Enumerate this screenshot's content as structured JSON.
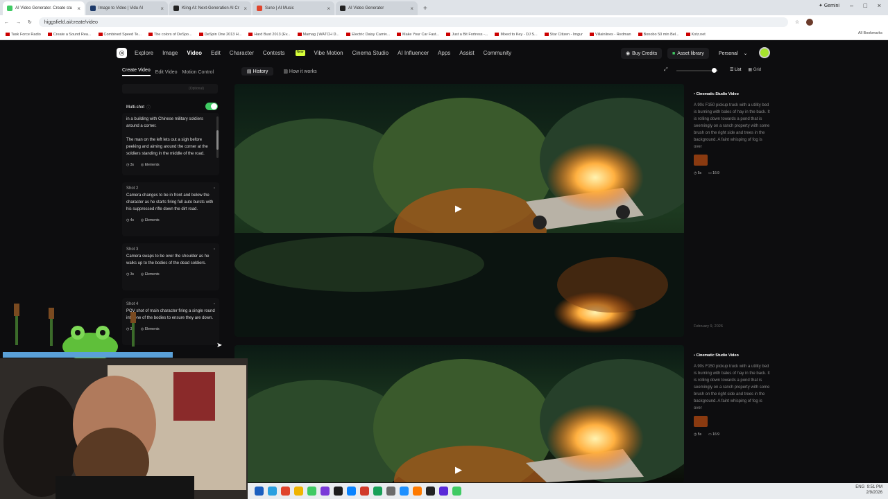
{
  "browser": {
    "tabs": [
      {
        "title": "AI Video Generator. Create stu",
        "color": "#3fca63",
        "active": true
      },
      {
        "title": "Image to Video | Vidu AI",
        "color": "#1d3a6a",
        "active": false
      },
      {
        "title": "Kling AI: Next-Generation AI Cr",
        "color": "#222222",
        "active": false
      },
      {
        "title": "Suno | AI Music",
        "color": "#e0442c",
        "active": false
      },
      {
        "title": "AI Video Generator",
        "color": "#222222",
        "active": false
      }
    ],
    "gemini_label": "Gemini",
    "url": "higgsfield.ai/create/video",
    "bookmarks": [
      "Task Force Radio",
      "Create a Sound Rea...",
      "Combined Speed Te...",
      "The colors of DeSpo...",
      "DeSpin One 2013 H...",
      "Hard Bust 2013 (Ev...",
      "Mamag | WATCH D...",
      "Electric Daisy Carniv...",
      "Make Your Car Fast...",
      "Just a Bit Fortress -...",
      "Mixed to Key - DJ S...",
      "Star Citizen - Imgur",
      "Villainlines - Redman",
      "Bonobo 50 min Bel...",
      "Kotz.net"
    ],
    "all_bookmarks": "All Bookmarks"
  },
  "nav": {
    "links": [
      "Explore",
      "Image",
      "Video",
      "Edit",
      "Character",
      "Contests",
      "Vibe Motion",
      "Cinema Studio",
      "AI Influencer",
      "Apps",
      "Assist",
      "Community"
    ],
    "active": "Video",
    "new_badge": "New",
    "buy_credits": "Buy Credits",
    "asset_library": "Asset library",
    "personal": "Personal"
  },
  "left": {
    "tabs": [
      "Create Video",
      "Edit Video",
      "Motion Control"
    ],
    "optional": "(Optional)",
    "multishot_label": "Multi-shot",
    "multishot_on": true,
    "shot1_text": "in a building with Chinese military soldiers around a corner.",
    "shot1_text2": "The man on the left lets out a sigh before peeking and aiming around the corner at the soldiers standing in the middle of the road.",
    "shots": [
      {
        "label": "Shot 2",
        "text": "Camera changes to be in front and below the character as he starts firing full auto bursts with his suppressed rifle down the dirt road.",
        "dur": "4s",
        "elements": "Elements"
      },
      {
        "label": "Shot 3",
        "text": "Camera swaps to be over the shoulder as he walks up to the bodies of the dead soldiers.",
        "dur": "3s",
        "elements": "Elements"
      },
      {
        "label": "Shot 4",
        "text": "POV shot of main character firing a single round into one of the bodies to ensure they are down.",
        "dur": "3s",
        "elements": "Elements"
      }
    ],
    "shot1_dur": "3s",
    "shot1_elements": "Elements"
  },
  "main": {
    "history": "History",
    "how": "How it works",
    "list": "List",
    "grid": "Grid",
    "cards": [
      {
        "title": "Cinematic Studio Video",
        "prompt": "A 90s F150 pickup truck with a utility bed is burning with bales of hay in the back. It is rolling down towards a pond that is seemingly on a ranch property with some brush on the right side and trees in the background. A faint whisping of fog is over",
        "dur": "5s",
        "ratio": "16:9",
        "date": "February 9, 2026"
      },
      {
        "title": "Cinematic Studio Video",
        "prompt": "A 90s F150 pickup truck with a utility bed is burning with bales of hay in the back. It is rolling down towards a pond that is seemingly on a ranch property with some brush on the right side and trees in the background. A faint whisping of fog is over",
        "dur": "5s",
        "ratio": "16:9"
      }
    ]
  },
  "tray": {
    "lang": "ENG",
    "time": "9:51 PM",
    "date": "2/9/2026"
  }
}
